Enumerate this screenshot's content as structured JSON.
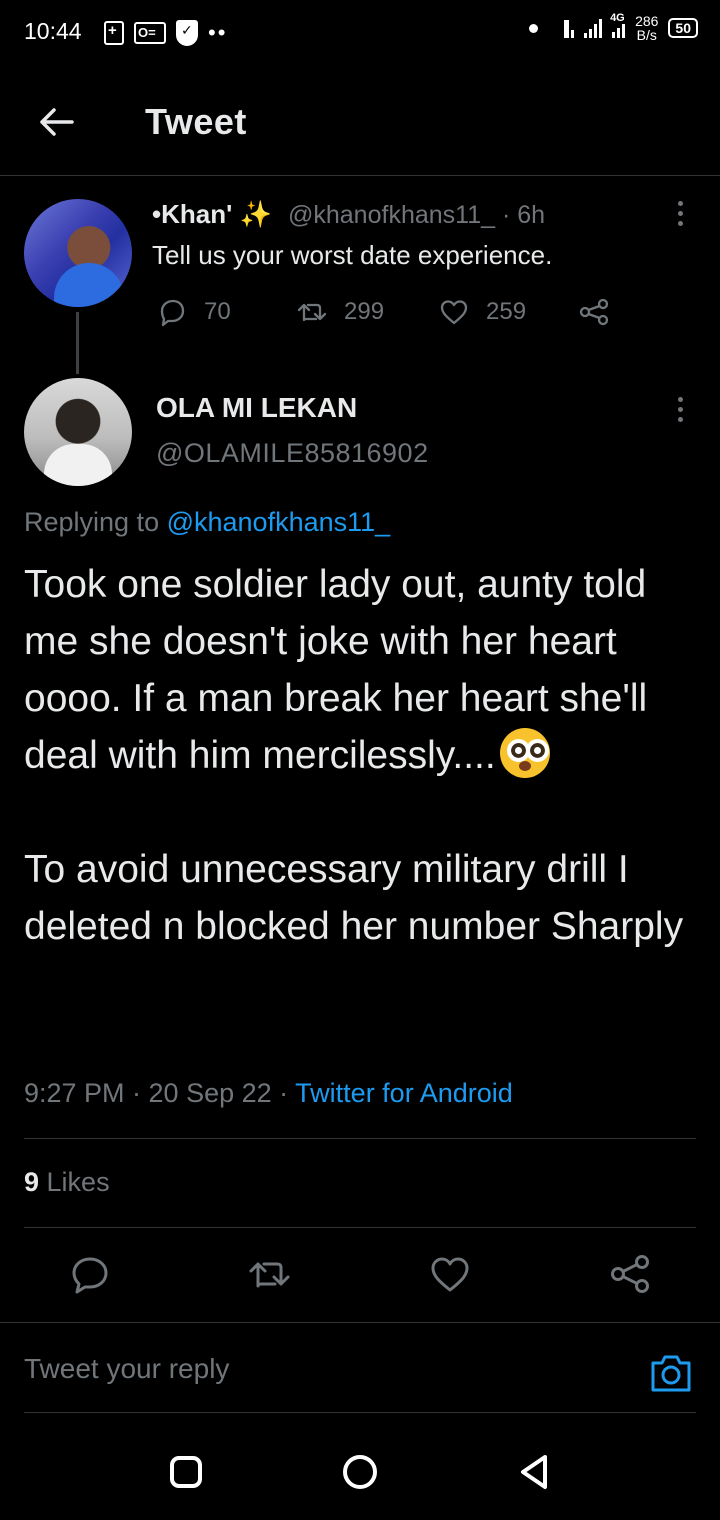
{
  "status_bar": {
    "time": "10:44",
    "network_type": "4G",
    "speed_value": "286",
    "speed_unit": "B/s",
    "battery": "50"
  },
  "header": {
    "title": "Tweet"
  },
  "parent_tweet": {
    "display_name": "•Khan'",
    "emoji": "✨",
    "handle_time": "@khanofkhans11_ · 6h",
    "text": "Tell us your worst date experience.",
    "replies": "70",
    "retweets": "299",
    "likes": "259"
  },
  "reply_tweet": {
    "display_name": "OLA MI LEKAN",
    "handle": "@OLAMILE85816902",
    "replying_prefix": "Replying to ",
    "replying_handle": "@khanofkhans11_",
    "text_line1": "Took one soldier lady out, aunty told me she doesn't joke with her heart oooo. If a man break her heart she'll deal with him mercilessly....",
    "text_line2": "To avoid unnecessary military drill I deleted n blocked her number Sharply",
    "time_date": "9:27 PM · 20 Sep 22 · ",
    "source": "Twitter for Android",
    "likes_count": "9",
    "likes_label": " Likes"
  },
  "reply_box": {
    "placeholder": "Tweet your reply"
  },
  "colors": {
    "accent": "#1d9bf0",
    "muted": "#71767b",
    "background": "#000000"
  }
}
